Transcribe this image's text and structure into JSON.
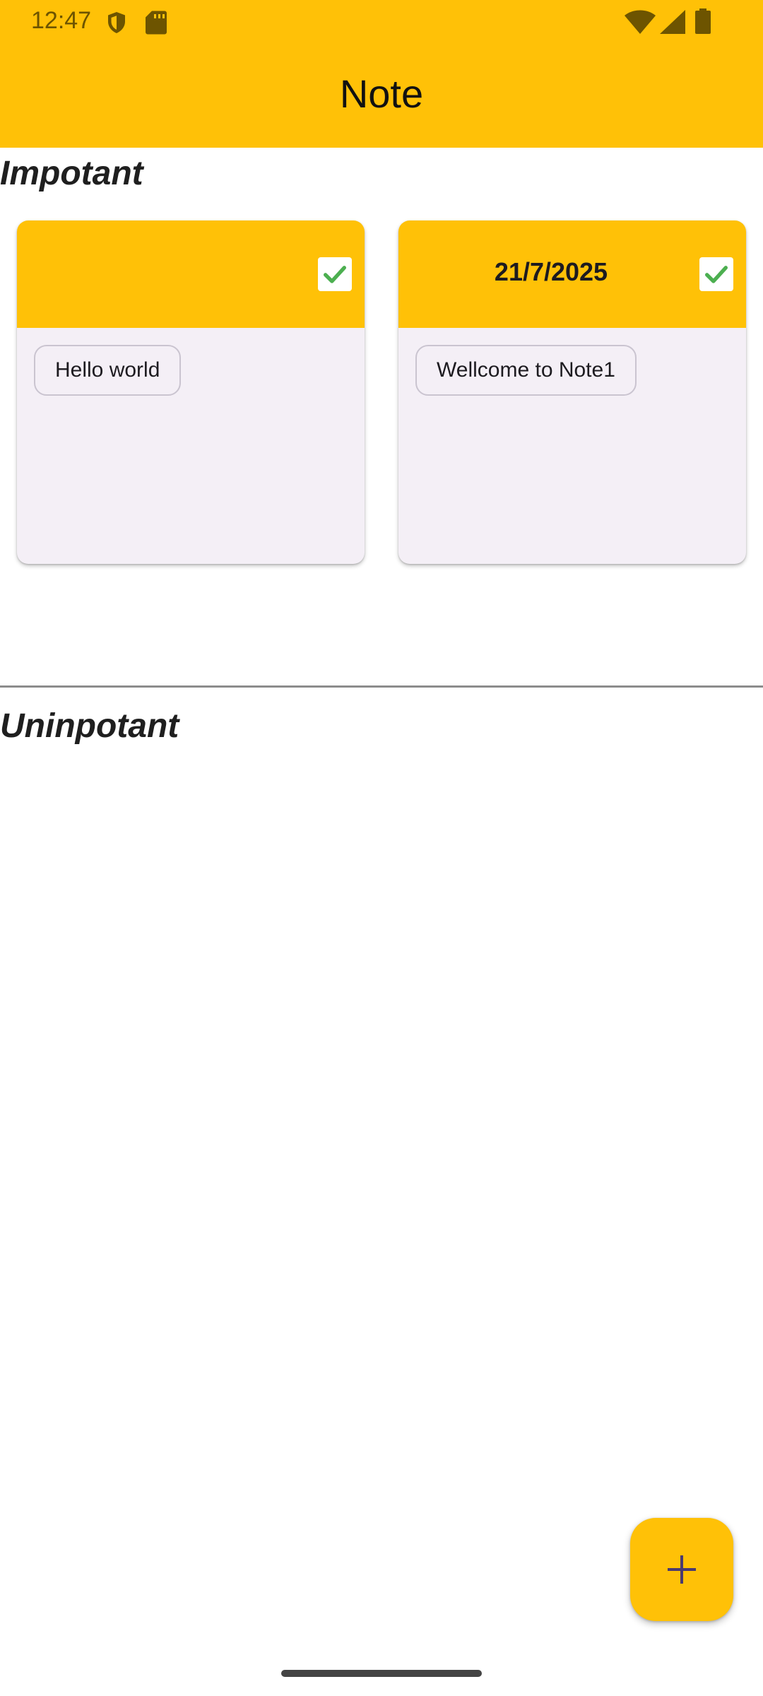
{
  "status_bar": {
    "time": "12:47",
    "icons": [
      "shield-icon",
      "sd-card-icon",
      "wifi-icon",
      "signal-icon",
      "battery-icon"
    ]
  },
  "app_bar": {
    "title": "Note",
    "color": "#FFC107"
  },
  "sections": {
    "important": {
      "title": "Impotant",
      "notes": [
        {
          "date": "",
          "checked": true,
          "chip": "Hello world"
        },
        {
          "date": "21/7/2025",
          "checked": true,
          "chip": "Wellcome to Note1"
        }
      ]
    },
    "unimportant": {
      "title": "Uninpotant",
      "notes": []
    }
  },
  "fab": {
    "icon": "plus-icon"
  },
  "colors": {
    "accent": "#FFC107",
    "card_body": "#F4EFF6",
    "check": "#4CAF50",
    "fab_icon": "#4a3a70"
  }
}
